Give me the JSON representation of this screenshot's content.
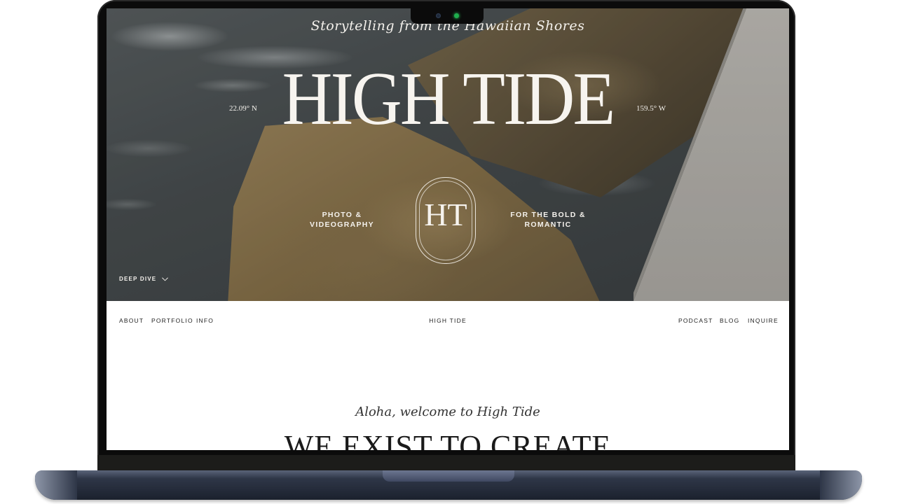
{
  "hero": {
    "tagline": "Storytelling from the Hawaiian Shores",
    "title": "HIGH TIDE",
    "latitude": "22.09° N",
    "longitude": "159.5° W",
    "left_caption_line1": "PHOTO &",
    "left_caption_line2": "VIDEOGRAPHY",
    "right_caption_line1": "FOR THE BOLD &",
    "right_caption_line2": "ROMANTIC",
    "monogram": "HT",
    "deep_dive_label": "DEEP DIVE"
  },
  "nav": {
    "left": [
      "ABOUT",
      "PORTFOLIO",
      "INFO"
    ],
    "brand": "HIGH TIDE",
    "right": [
      "PODCAST",
      "BLOG",
      "INQUIRE"
    ]
  },
  "content": {
    "welcome": "Aloha, welcome to High Tide",
    "headline": "WE EXIST TO CREATE"
  },
  "icons": {
    "deep_dive": "chevron-down-icon",
    "camera": "camera-icon"
  },
  "colors": {
    "text_light": "#f4f1ec",
    "nav_text": "#222222",
    "camera_led": "#1fae4d"
  }
}
